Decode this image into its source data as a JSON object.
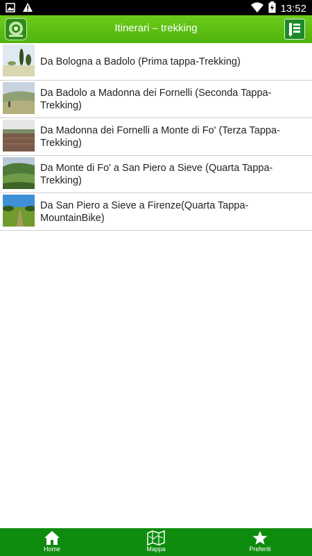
{
  "status_bar": {
    "time": "13:52",
    "left_icons": [
      "image-icon",
      "warning-icon"
    ],
    "right_icons": [
      "wifi-icon",
      "battery-icon"
    ]
  },
  "header": {
    "title": "Itinerari – trekking",
    "logo_icon": "app-logo-icon",
    "menu_icon": "list-menu-icon"
  },
  "items": [
    {
      "label": "Da Bologna a Badolo (Prima tappa-Trekking)"
    },
    {
      "label": "Da Badolo a Madonna dei Fornelli (Seconda Tappa-Trekking)"
    },
    {
      "label": "Da Madonna dei Fornelli a Monte di Fo' (Terza Tappa-Trekking)"
    },
    {
      "label": "Da Monte di Fo' a San Piero a Sieve (Quarta Tappa-Trekking)"
    },
    {
      "label": "Da San Piero a Sieve a Firenze(Quarta Tappa-MountainBike)"
    }
  ],
  "bottom_nav": {
    "home_label": "Home",
    "map_label": "Mappa",
    "favorites_label": "Preferiti"
  },
  "colors": {
    "app_bar": "#5fc015",
    "bottom_nav": "#0e8c0e",
    "status_bar": "#000000"
  }
}
